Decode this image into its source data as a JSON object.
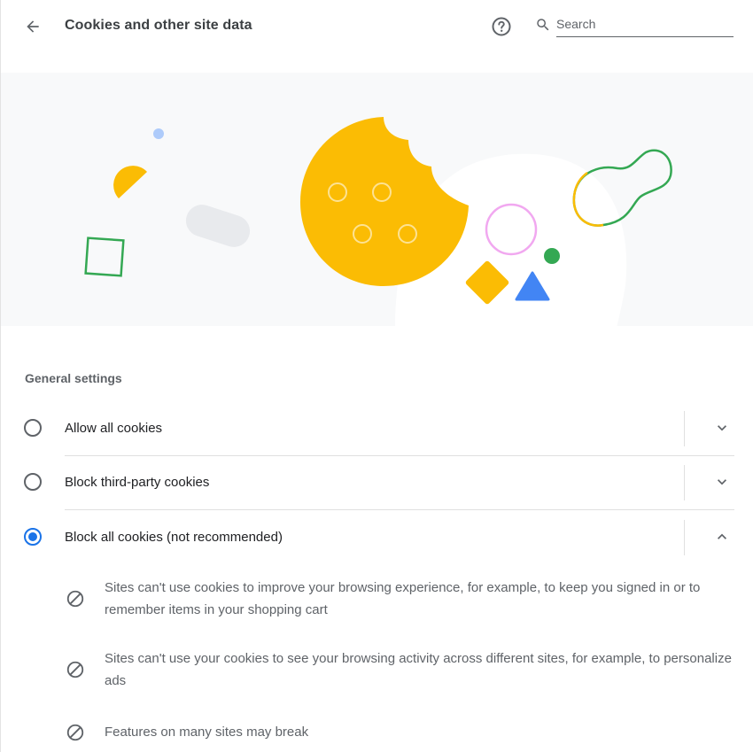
{
  "header": {
    "title": "Cookies and other site data",
    "back_icon": "arrow-back-icon",
    "help_icon": "help-circle-icon",
    "search": {
      "icon": "search-icon",
      "placeholder": "Search",
      "value": ""
    }
  },
  "general_settings": {
    "title": "General settings",
    "options": [
      {
        "label": "Allow all cookies",
        "selected": false,
        "expanded": false
      },
      {
        "label": "Block third-party cookies",
        "selected": false,
        "expanded": false
      },
      {
        "label": "Block all cookies (not recommended)",
        "selected": true,
        "expanded": true
      }
    ],
    "block_all_details": [
      {
        "icon": "block-icon",
        "text": "Sites can't use cookies to improve your browsing experience, for example, to keep you signed in or to remember items in your shopping cart"
      },
      {
        "icon": "block-icon",
        "text": "Sites can't use your cookies to see your browsing activity across different sites, for example, to personalize ads"
      },
      {
        "icon": "block-icon",
        "text": "Features on many sites may break"
      }
    ]
  },
  "colors": {
    "accent": "#1a73e8",
    "cookie_yellow": "#fbbc04",
    "green": "#34a853",
    "blue": "#4285f4",
    "pink": "#f6aea9"
  }
}
